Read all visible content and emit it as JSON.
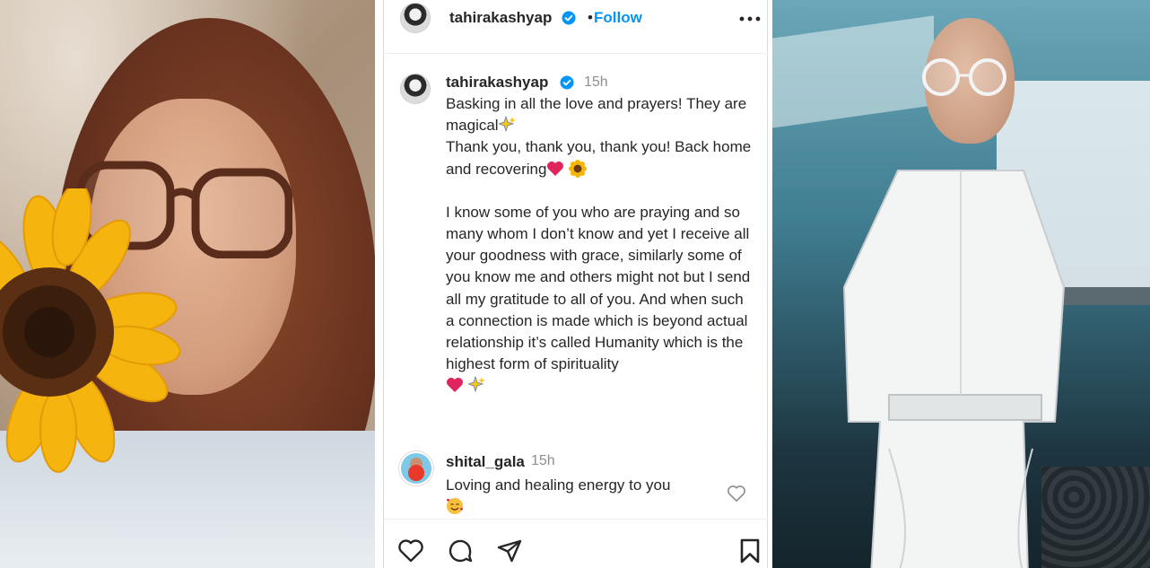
{
  "post": {
    "header": {
      "username": "tahirakashyap",
      "separator": "•",
      "follow_label": "Follow"
    },
    "caption": {
      "username": "tahirakashyap",
      "time": "15h",
      "line1": "Basking in all the love and prayers! They are magical",
      "line2": "Thank you, thank you, thank you! Back home and recovering",
      "paragraph2": "I know some of you who are praying and so many whom I don’t know and yet I receive all your goodness with grace, similarly some of you know me and others might not but I send all my gratitude to all of you. And when such a connection is made which is beyond actual relationship it’s called Humanity which is the highest form of spirituality"
    },
    "comment": {
      "username": "shital_gala",
      "time": "15h",
      "text": "Loving and healing energy to you"
    },
    "actions": {
      "like_icon": "heart-outline-icon",
      "comment_icon": "speech-bubble-icon",
      "share_icon": "paper-plane-icon",
      "save_icon": "bookmark-icon"
    },
    "colors": {
      "accent": "#0095f6",
      "verified": "#0095f6",
      "text": "#262626",
      "muted": "#8e8e8e"
    }
  }
}
